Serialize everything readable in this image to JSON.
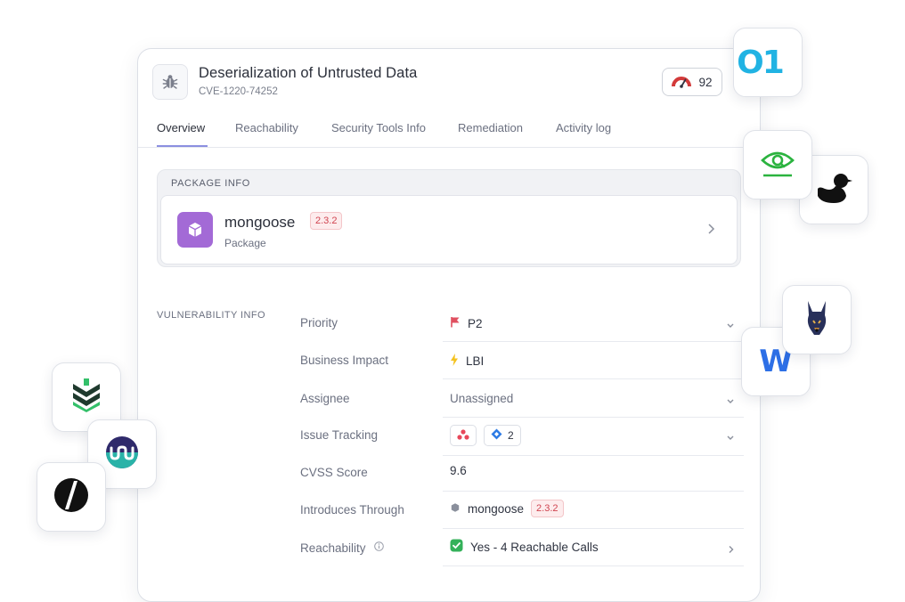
{
  "header": {
    "title": "Deserialization of Untrusted Data",
    "cve_id": "CVE-1220-74252",
    "score": "92",
    "score_color": "#d33a3a"
  },
  "tabs": [
    {
      "label": "Overview",
      "active": true
    },
    {
      "label": "Reachability"
    },
    {
      "label": "Security Tools Info"
    },
    {
      "label": "Remediation"
    },
    {
      "label": "Activity log"
    }
  ],
  "package_info": {
    "heading": "PACKAGE INFO",
    "name": "mongoose",
    "version": "2.3.2",
    "type": "Package",
    "icon": "box-icon",
    "icon_color": "#a36ad6"
  },
  "vulnerability_info": {
    "heading": "VULNERABILITY INFO",
    "rows": [
      {
        "label": "Priority",
        "value": "P2",
        "icon": "flag-icon"
      },
      {
        "label": "Business Impact",
        "value": "LBI",
        "icon": "lightning-icon"
      },
      {
        "label": "Assignee",
        "value": "Unassigned"
      },
      {
        "label": "Issue Tracking",
        "jira_count": "2"
      },
      {
        "label": "CVSS Score",
        "value": "9.6"
      },
      {
        "label": "Introduces Through",
        "value": "mongoose",
        "version": "2.3.2"
      },
      {
        "label": "Reachability",
        "value": "Yes - 4 Reachable Calls",
        "icon": "check-icon"
      }
    ]
  },
  "floating_tools": [
    {
      "name": "o1-logo",
      "text": "O1"
    },
    {
      "name": "eye-logo"
    },
    {
      "name": "duck-logo"
    },
    {
      "name": "doberman-logo"
    },
    {
      "name": "w-logo",
      "text": "W"
    },
    {
      "name": "chevron-shield-logo"
    },
    {
      "name": "wave-circle-logo"
    },
    {
      "name": "slash-circle-logo"
    }
  ]
}
